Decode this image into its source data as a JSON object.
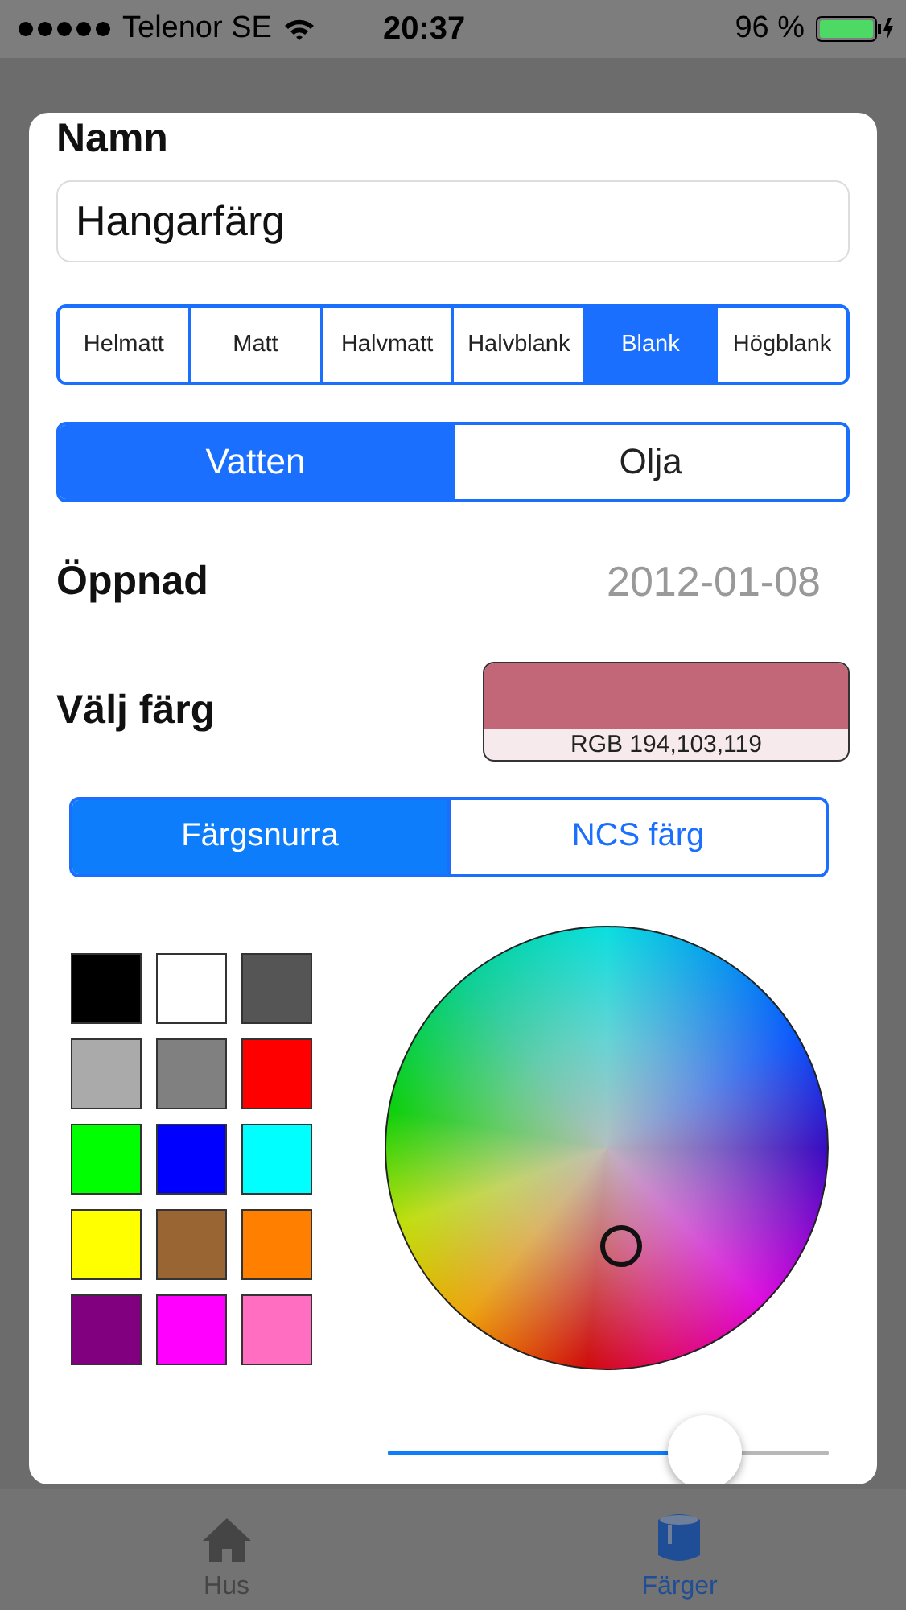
{
  "status_bar": {
    "carrier": "Telenor SE",
    "time": "20:37",
    "battery": "96 %"
  },
  "form": {
    "name_label": "Namn",
    "name_value": "Hangarfärg",
    "finish": [
      {
        "label": "Helmatt",
        "selected": false
      },
      {
        "label": "Matt",
        "selected": false
      },
      {
        "label": "Halvmatt",
        "selected": false
      },
      {
        "label": "Halvblank",
        "selected": false
      },
      {
        "label": "Blank",
        "selected": true
      },
      {
        "label": "Högblank",
        "selected": false
      }
    ],
    "base": [
      {
        "label": "Vatten",
        "selected": true
      },
      {
        "label": "Olja",
        "selected": false
      }
    ],
    "opened_label": "Öppnad",
    "opened_value": "2012-01-08",
    "pick_label": "Välj färg",
    "current_color": {
      "color": "#c26777",
      "caption": "RGB 194,103,119"
    },
    "picker_modes": [
      {
        "label": "Färgsnurra",
        "selected": true
      },
      {
        "label": "NCS färg",
        "selected": false
      }
    ],
    "swatches": [
      {
        "color": "#000000"
      },
      {
        "color": "#ffffff"
      },
      {
        "color": "#555555"
      },
      {
        "color": "#aaaaaa"
      },
      {
        "color": "#808080"
      },
      {
        "color": "#ff0000"
      },
      {
        "color": "#00ff00"
      },
      {
        "color": "#0000ff"
      },
      {
        "color": "#00ffff"
      },
      {
        "color": "#ffff00"
      },
      {
        "color": "#996633"
      },
      {
        "color": "#ff8000"
      },
      {
        "color": "#800080"
      },
      {
        "color": "#ff00ff"
      },
      {
        "color": "#ff6ec0"
      }
    ],
    "brightness": {
      "level": 0.72
    }
  },
  "tab_bar": [
    {
      "label": "Hus",
      "selected": false
    },
    {
      "label": "Färger",
      "selected": true
    }
  ]
}
